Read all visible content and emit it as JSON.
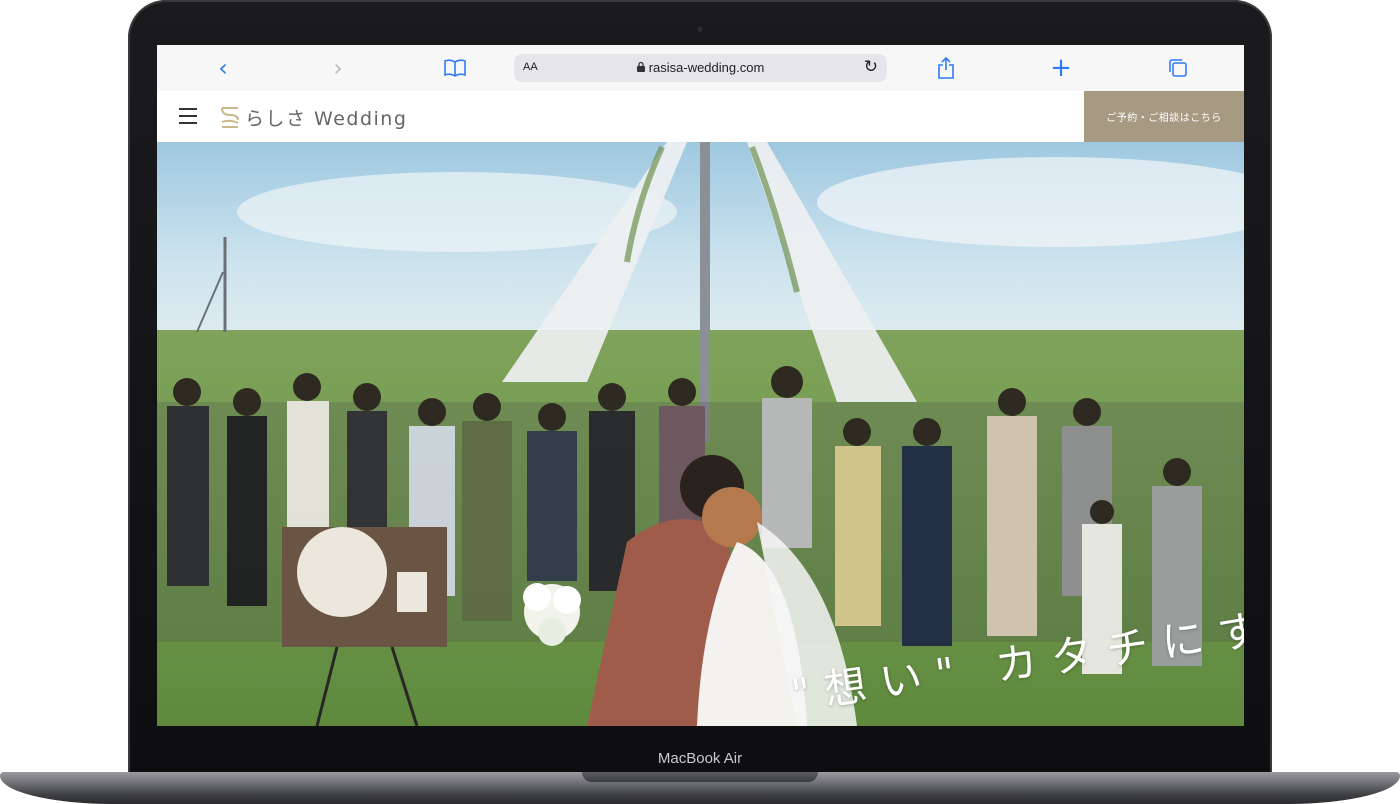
{
  "device": {
    "model_label": "MacBook Air"
  },
  "browser": {
    "address_text_size_label": "AA",
    "url": "rasisa-wedding.com",
    "icons": [
      "back-icon",
      "forward-icon",
      "bookmarks-icon",
      "reload-icon",
      "share-icon",
      "new-tab-icon",
      "tabs-icon"
    ]
  },
  "site": {
    "logo_text": "らしさ Wedding",
    "reserve_button": "ご予約・ご相談はこちら",
    "brand_colors": {
      "accent": "#a79a82",
      "logo_mark": "#c9b98a"
    }
  },
  "hero": {
    "caption": "\"想い\" カタチにする",
    "alt": ""
  }
}
